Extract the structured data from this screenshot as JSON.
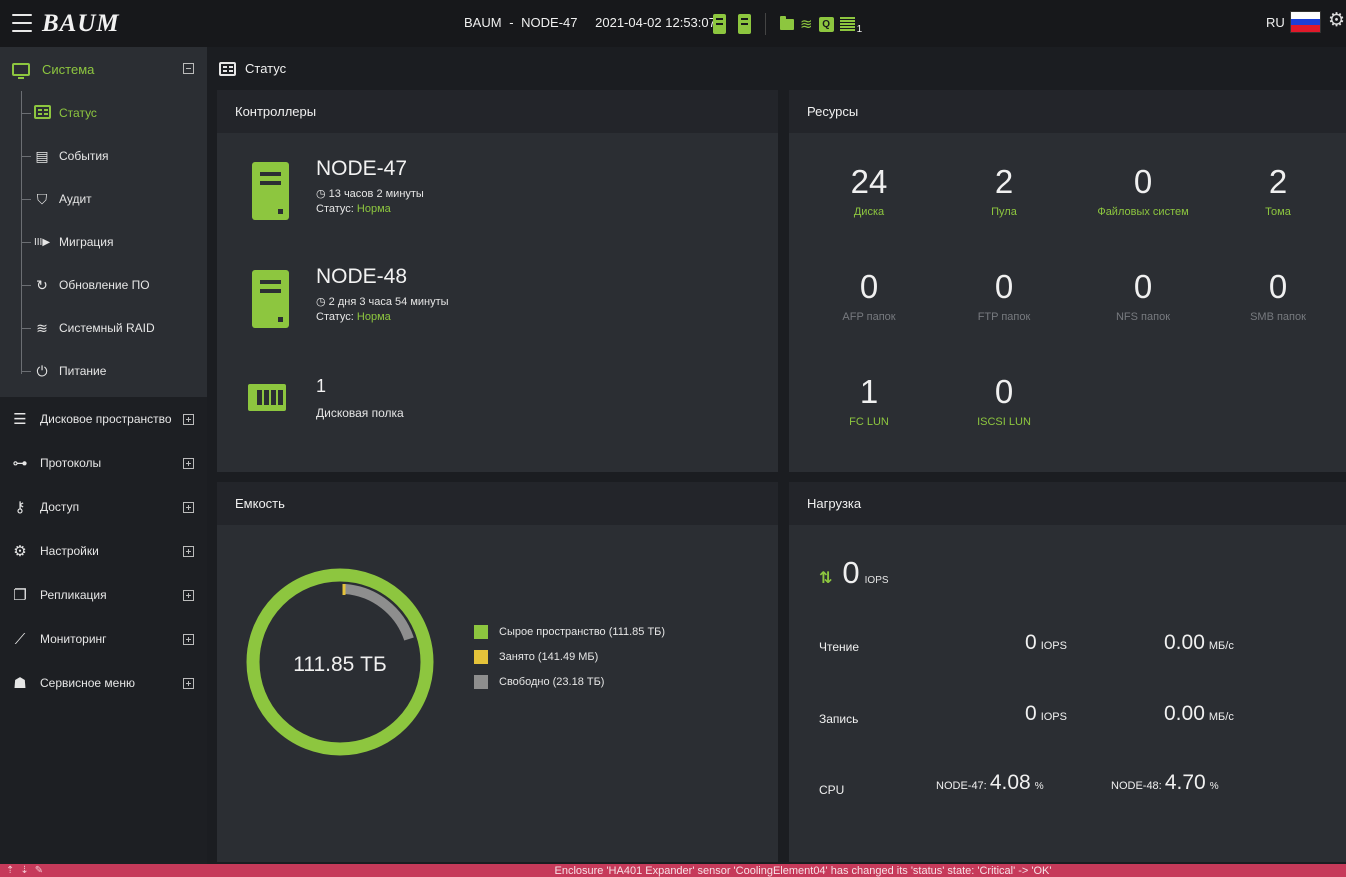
{
  "topbar": {
    "logo": "BAUM",
    "system": "BAUM",
    "dash": "-",
    "node": "NODE-47",
    "datetime": "2021-04-02 12:53:07",
    "enclosure_count": "1",
    "lang": "RU",
    "accent_color": "#8dc63f"
  },
  "sidebar": {
    "system_label": "Система",
    "subitems": [
      {
        "label": "Статус",
        "icon": "status-icon"
      },
      {
        "label": "События",
        "icon": "events-icon"
      },
      {
        "label": "Аудит",
        "icon": "shield-check-icon"
      },
      {
        "label": "Миграция",
        "icon": "migration-icon"
      },
      {
        "label": "Обновление ПО",
        "icon": "refresh-icon"
      },
      {
        "label": "Системный RAID",
        "icon": "layers-icon"
      },
      {
        "label": "Питание",
        "icon": "power-icon"
      }
    ],
    "items": [
      {
        "label": "Дисковое пространство",
        "icon": "database-icon"
      },
      {
        "label": "Протоколы",
        "icon": "network-icon"
      },
      {
        "label": "Доступ",
        "icon": "key-icon"
      },
      {
        "label": "Настройки",
        "icon": "gear-icon"
      },
      {
        "label": "Репликация",
        "icon": "copy-icon"
      },
      {
        "label": "Мониторинг",
        "icon": "chart-icon"
      },
      {
        "label": "Сервисное меню",
        "icon": "user-gear-icon"
      }
    ]
  },
  "breadcrumb": {
    "label": "Статус"
  },
  "controllers": {
    "title": "Контроллеры",
    "nodes": [
      {
        "name": "NODE-47",
        "uptime": "13 часов 2 минуты",
        "status_label": "Статус:",
        "status_value": "Норма"
      },
      {
        "name": "NODE-48",
        "uptime": "2 дня 3 часа 54 минуты",
        "status_label": "Статус:",
        "status_value": "Норма"
      }
    ],
    "shelf": {
      "count": "1",
      "label": "Дисковая полка"
    }
  },
  "resources": {
    "title": "Ресурсы",
    "items": [
      {
        "value": "24",
        "label": "Диска"
      },
      {
        "value": "2",
        "label": "Пула"
      },
      {
        "value": "0",
        "label": "Файловых систем"
      },
      {
        "value": "2",
        "label": "Тома"
      },
      {
        "value": "0",
        "label": "AFP папок"
      },
      {
        "value": "0",
        "label": "FTP папок"
      },
      {
        "value": "0",
        "label": "NFS папок"
      },
      {
        "value": "0",
        "label": "SMB папок"
      },
      {
        "value": "1",
        "label": "FC LUN"
      },
      {
        "value": "0",
        "label": "ISCSI LUN"
      }
    ]
  },
  "capacity": {
    "title": "Емкость",
    "center": "111.85 ТБ",
    "legend": [
      {
        "label": "Сырое пространство (111.85 ТБ)",
        "color": "#8dc63f"
      },
      {
        "label": "Занято (141.49 МБ)",
        "color": "#e5c33a"
      },
      {
        "label": "Свободно (23.18 ТБ)",
        "color": "#8e8e8e"
      }
    ]
  },
  "load": {
    "title": "Нагрузка",
    "total_iops": "0",
    "iops_unit": "IOPS",
    "mbs_unit": "МБ/с",
    "read_label": "Чтение",
    "read_iops": "0",
    "read_mbs": "0.00",
    "write_label": "Запись",
    "write_iops": "0",
    "write_mbs": "0.00",
    "cpu_label": "CPU",
    "cpu_node47_label": "NODE-47:",
    "cpu_node47": "4.08",
    "cpu_node48_label": "NODE-48:",
    "cpu_node48": "4.70",
    "cpu_unit": "%"
  },
  "notification": {
    "message": "Enclosure 'HA401 Expander' sensor 'CoolingElement04' has changed its 'status' state: 'Critical' -> 'OK'"
  }
}
